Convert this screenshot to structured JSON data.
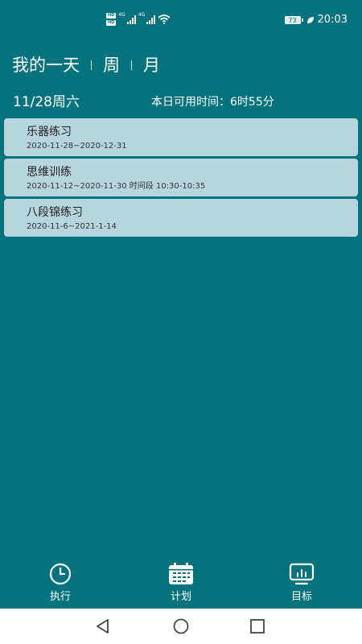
{
  "status_bar": {
    "hd1": "HD",
    "hd2": "HD",
    "net1": "4G",
    "net2": "4G",
    "battery": "73",
    "time": "20:03"
  },
  "header": {
    "tabs": [
      {
        "label": "我的一天"
      },
      {
        "label": "周"
      },
      {
        "label": "月"
      }
    ],
    "date": "11/28周六",
    "available_time": "本日可用时间：6时55分"
  },
  "tasks": [
    {
      "title": "乐器练习",
      "subtitle": "2020-11-28~2020-12-31"
    },
    {
      "title": "思维训练",
      "subtitle": "2020-11-12~2020-11-30 时间段 10:30-10:35"
    },
    {
      "title": "八段锦练习",
      "subtitle": "2020-11-6~2021-1-14"
    }
  ],
  "bottom_nav": {
    "items": [
      {
        "label": "执行",
        "icon": "clock-icon"
      },
      {
        "label": "计划",
        "icon": "calendar-icon"
      },
      {
        "label": "目标",
        "icon": "monitor-icon"
      }
    ]
  },
  "colors": {
    "background": "#04737d",
    "card": "#b7d5dd",
    "system_bar": "#ffffff"
  }
}
